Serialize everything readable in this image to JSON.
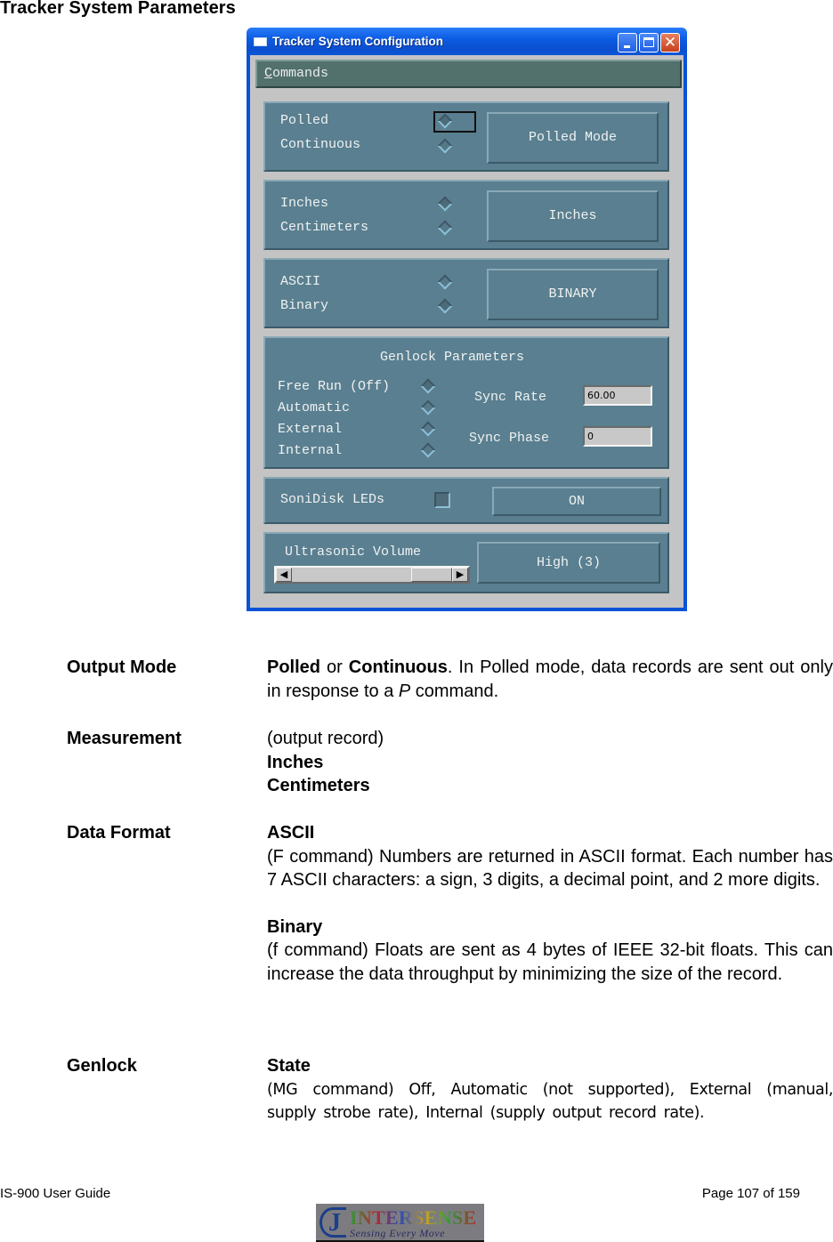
{
  "page": {
    "heading": "Tracker System Parameters"
  },
  "window": {
    "title": "Tracker System Configuration",
    "controls": {
      "minimize": "minimize",
      "maximize": "maximize",
      "close": "✕"
    },
    "menu": {
      "commands_first": "C",
      "commands_rest": "ommands"
    },
    "output_mode": {
      "options": [
        "Polled",
        "Continuous"
      ],
      "selected": "Polled",
      "button": "Polled Mode"
    },
    "units": {
      "options": [
        "Inches",
        "Centimeters"
      ],
      "selected": "Inches",
      "button": "Inches"
    },
    "data_format": {
      "options": [
        "ASCII",
        "Binary"
      ],
      "selected": "Binary",
      "button": "BINARY"
    },
    "genlock": {
      "title": "Genlock Parameters",
      "options": [
        "Free Run (Off)",
        "Automatic",
        "External",
        "Internal"
      ],
      "selected": "Free Run (Off)",
      "sync_rate_label": "Sync Rate",
      "sync_rate_value": "60.00",
      "sync_phase_label": "Sync Phase",
      "sync_phase_value": "0"
    },
    "sonidisk": {
      "label": "SoniDisk LEDs",
      "checked": true,
      "button": "ON"
    },
    "volume": {
      "label": "Ultrasonic Volume",
      "level": 3,
      "max_level": 3,
      "left_arrow": "◀",
      "right_arrow": "▶",
      "button": "High (3)"
    }
  },
  "doc": {
    "output_mode": {
      "term": "Output Mode",
      "b1": "Polled",
      "t1": " or ",
      "b2": "Continuous",
      "t2": ".  In Polled mode, data records are sent out only in response to a ",
      "i1": "P",
      "t3": " command."
    },
    "measurement": {
      "term": "Measurement",
      "line1": "(output record)",
      "b1": "Inches",
      "b2": "Centimeters"
    },
    "data_format": {
      "term": "Data Format",
      "ascii_title": "ASCII",
      "ascii_text": "(F command) Numbers are returned in ASCII format.  Each number has 7 ASCII characters: a sign, 3 digits, a decimal point, and 2 more digits.",
      "binary_title": "Binary",
      "binary_text": "(f command)  Floats are sent as 4 bytes of IEEE 32-bit floats. This can increase the data throughput by minimizing the size of the record."
    },
    "genlock": {
      "term": "Genlock",
      "state_title": "State",
      "state_text": "(MG command) Off, Automatic (not supported), External (manual, supply strobe rate), Internal (supply output record rate)."
    }
  },
  "footer": {
    "left": "IS-900 User Guide",
    "right": "Page 107 of 159",
    "logo_name": "INTERSENSE",
    "logo_tagline": "Sensing Every Move"
  }
}
